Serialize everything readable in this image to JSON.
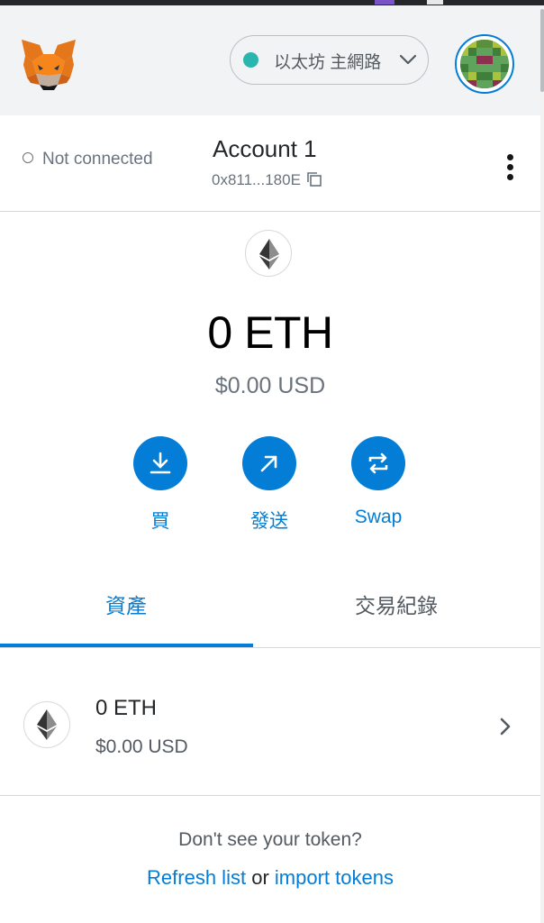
{
  "header": {
    "network_label": "以太坊 主網路",
    "network_status_color": "#29b6af"
  },
  "account": {
    "connection_status": "Not connected",
    "name": "Account 1",
    "address": "0x811...180E"
  },
  "balance": {
    "primary": "0 ETH",
    "secondary": "$0.00 USD"
  },
  "actions": {
    "buy_label": "買",
    "send_label": "發送",
    "swap_label": "Swap"
  },
  "tabs": {
    "assets_label": "資產",
    "activity_label": "交易紀錄"
  },
  "assets": [
    {
      "amount": "0 ETH",
      "fiat": "$0.00 USD"
    }
  ],
  "footer": {
    "help_text": "Don't see your token?",
    "refresh_label": "Refresh list",
    "or_text": "or",
    "import_label": "import tokens"
  },
  "colors": {
    "accent": "#037dd6",
    "header_bg": "#f2f3f4",
    "muted_text": "#6a737d"
  },
  "icons": {
    "logo": "metamask-fox-logo",
    "network_dropdown": "chevron-down-icon",
    "copy": "copy-icon",
    "menu": "kebab-menu-icon",
    "buy": "download-arrow-icon",
    "send": "arrow-up-right-icon",
    "swap": "swap-arrows-icon",
    "asset": "ethereum-icon",
    "asset_open": "chevron-right-icon"
  }
}
